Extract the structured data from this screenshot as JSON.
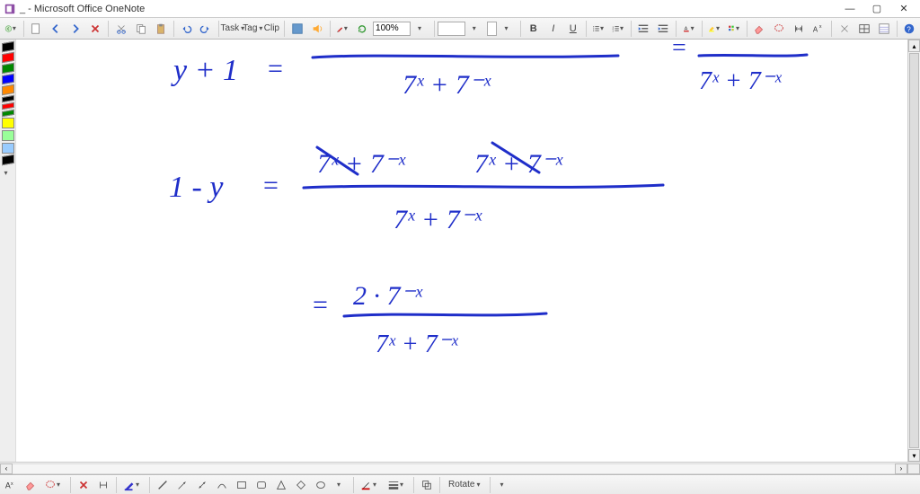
{
  "window": {
    "title": "_ - Microsoft Office OneNote",
    "min": "—",
    "max": "▢",
    "close": "✕"
  },
  "toolbar": {
    "task_label": "Task",
    "tag_label": "Tag",
    "clip_label": "Clip",
    "zoom_value": "100%",
    "b": "B",
    "i": "I",
    "u": "U"
  },
  "palette_colors": [
    "#000000",
    "#ff0000",
    "#008000",
    "#0000ff",
    "#ff8800",
    "#ffff00",
    "#cccc00",
    "#c0c0c0",
    "#6699ff",
    "#000000"
  ],
  "bottombar": {
    "rotate_label": "Rotate"
  },
  "scroll": {
    "left": "‹",
    "right": "›",
    "up": "▴",
    "down": "▾"
  },
  "handwriting": {
    "line1_lhs": "y + 1",
    "line1_eq": "=",
    "line1_den": "7ˣ + 7⁻ˣ",
    "line1_rfrac_num_eq": "=",
    "line1_rfrac_den": "7ˣ + 7⁻ˣ",
    "line2_lhs": "1 - y",
    "line2_eq": "=",
    "line2_num_a": "7ˣ + 7⁻ˣ",
    "line2_num_b": "7ˣ + 7⁻ˣ",
    "line2_den": "7ˣ + 7⁻ˣ",
    "line3_eq": "=",
    "line3_num": "2 · 7⁻ˣ",
    "line3_den": "7ˣ + 7⁻ˣ"
  }
}
